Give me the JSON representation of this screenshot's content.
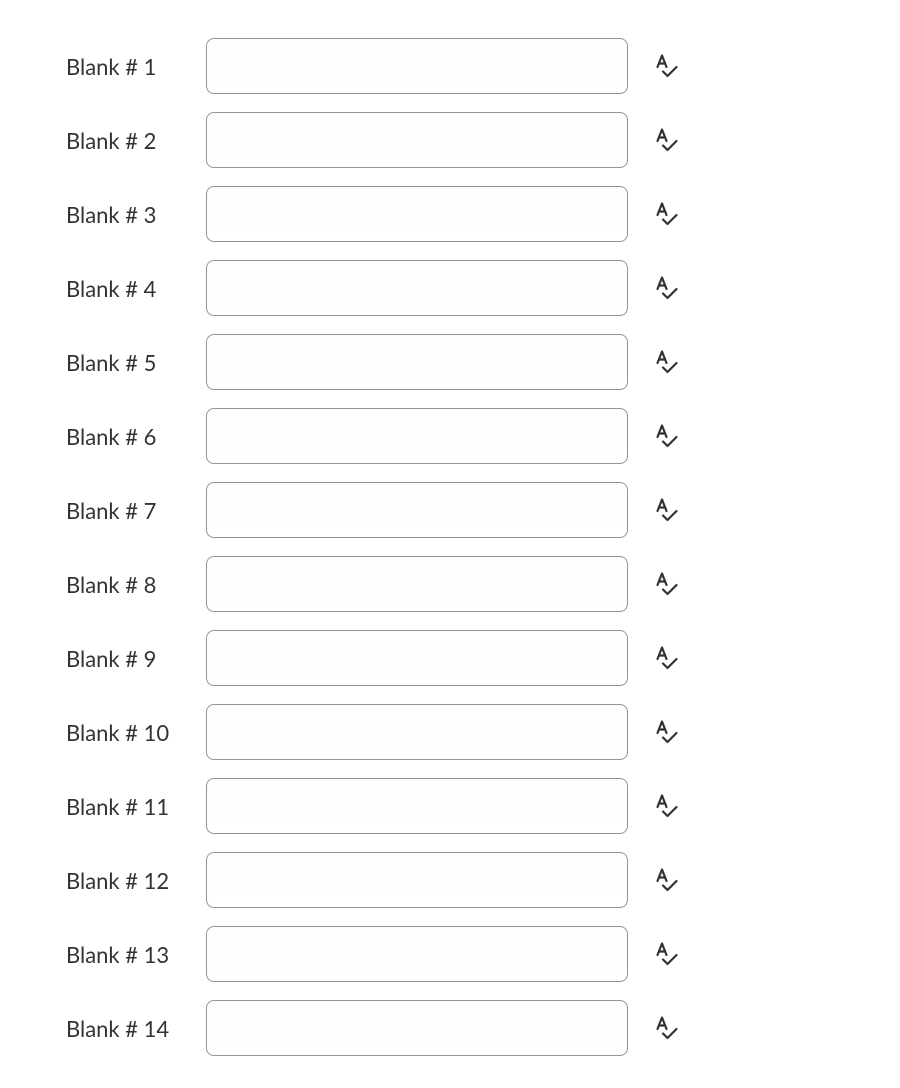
{
  "blanks": [
    {
      "label": "Blank # 1",
      "value": ""
    },
    {
      "label": "Blank # 2",
      "value": ""
    },
    {
      "label": "Blank # 3",
      "value": ""
    },
    {
      "label": "Blank # 4",
      "value": ""
    },
    {
      "label": "Blank # 5",
      "value": ""
    },
    {
      "label": "Blank # 6",
      "value": ""
    },
    {
      "label": "Blank # 7",
      "value": ""
    },
    {
      "label": "Blank # 8",
      "value": ""
    },
    {
      "label": "Blank # 9",
      "value": ""
    },
    {
      "label": "Blank # 10",
      "value": ""
    },
    {
      "label": "Blank # 11",
      "value": ""
    },
    {
      "label": "Blank # 12",
      "value": ""
    },
    {
      "label": "Blank # 13",
      "value": ""
    },
    {
      "label": "Blank # 14",
      "value": ""
    }
  ],
  "icons": {
    "spellcheck": "spellcheck-icon"
  }
}
